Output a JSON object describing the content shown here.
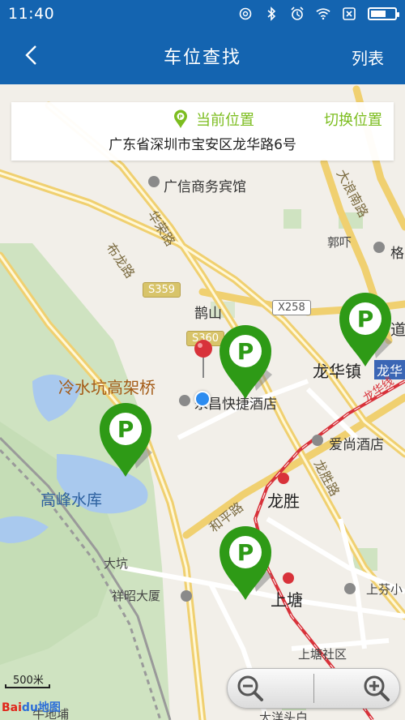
{
  "status_bar": {
    "time": "11:40"
  },
  "header": {
    "title": "车位查找",
    "right_action": "列表"
  },
  "info_card": {
    "current_location_label": "当前位置",
    "switch_location_label": "切换位置",
    "address": "广东省深圳市宝安区龙华路6号"
  },
  "map": {
    "labels": {
      "hotel_guangxin": "广信商务宾馆",
      "road_huarong": "华荣路",
      "road_buolong": "布龙路",
      "road_dalang": "大浪南路",
      "gexia": "郭吓",
      "ge": "格",
      "queshan": "鹊山",
      "lengshuikeng": "冷水坑高架桥",
      "longhua_town": "龙华镇",
      "longhua_sign": "龙华",
      "dao": "道",
      "hotel_yongchang": "永昌快捷酒店",
      "hotel_aishang": "爱尚酒店",
      "longhua_line": "龙华线",
      "gaofeng_reservoir": "高峰水库",
      "longsheng": "龙胜",
      "road_longsheng": "龙胜路",
      "road_heping": "和平路",
      "dakeng": "大坑",
      "xiangzhao": "祥昭大厦",
      "shangtang": "上塘",
      "shangfen": "上芬小",
      "shangtang_community": "上塘社区",
      "road_lu": "路",
      "bottom_left": "牛地埔",
      "bottom_mid": "大洋头白"
    },
    "shields": {
      "s359": "S359",
      "s360": "S360",
      "x258": "X258"
    },
    "scale": "500米",
    "logo_bai": "Bai",
    "logo_du": "du地图"
  },
  "colors": {
    "header_bg": "#1464b0",
    "accent_green": "#7cbd1f",
    "marker_green": "#2e9a16",
    "metro_red": "#d8323a"
  }
}
